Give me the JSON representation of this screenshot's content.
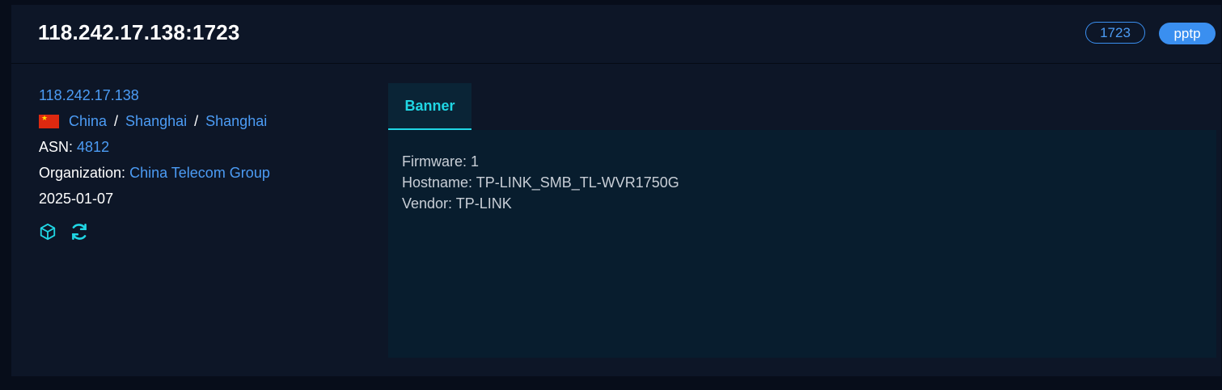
{
  "header": {
    "title": "118.242.17.138:1723",
    "port_tag": "1723",
    "protocol_tag": "pptp"
  },
  "info": {
    "ip": "118.242.17.138",
    "country": "China",
    "region": "Shanghai",
    "city": "Shanghai",
    "separator": "/",
    "asn_label": "ASN:",
    "asn_value": "4812",
    "org_label": "Organization:",
    "org_value": "China Telecom Group",
    "date": "2025-01-07",
    "icons": [
      "cube-icon",
      "refresh-icon"
    ]
  },
  "tabs": [
    {
      "label": "Banner",
      "active": true
    }
  ],
  "banner": {
    "lines": [
      "Firmware: 1",
      "Hostname: TP-LINK_SMB_TL-WVR1750G",
      "Vendor: TP-LINK"
    ]
  },
  "colors": {
    "background": "#070d1a",
    "card": "#0d1627",
    "link": "#4c9cf5",
    "accent": "#20d6e4",
    "tag_blue": "#3a8ff0",
    "flag_red": "#de2910"
  }
}
